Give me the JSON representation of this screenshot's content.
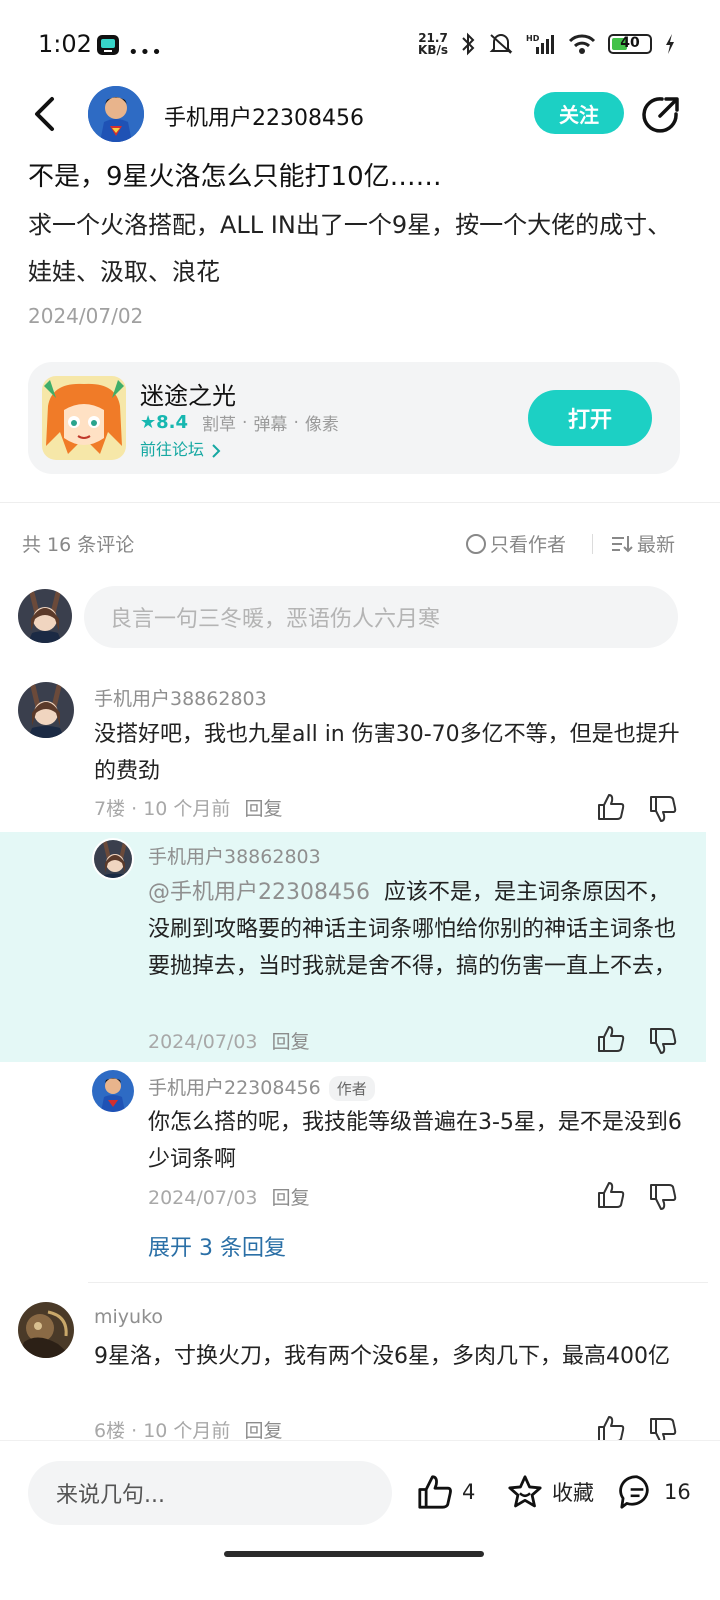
{
  "status_bar": {
    "time": "1:02",
    "net_speed_value": "21.7",
    "net_speed_unit": "KB/s",
    "battery": "40"
  },
  "post": {
    "author": "手机用户22308456",
    "follow_label": "关注",
    "title": "不是，9星火洛怎么只能打10亿……",
    "body": "求一个火洛搭配，ALL IN出了一个9星，按一个大佬的成寸、娃娃、汲取、浪花",
    "date": "2024/07/02"
  },
  "game_card": {
    "name": "迷途之光",
    "rating": "8.4",
    "tags": [
      "割草",
      "弹幕",
      "像素"
    ],
    "forum_link": "前往论坛",
    "open_label": "打开"
  },
  "comments_header": {
    "count_text": "共 16 条评论",
    "only_author": "只看作者",
    "sort": "最新"
  },
  "comment_input": {
    "placeholder": "良言一句三冬暖，恶语伤人六月寒"
  },
  "comments": [
    {
      "user": "手机用户38862803",
      "text": "没搭好吧，我也九星all in 伤害30-70多亿不等，但是也提升的费劲",
      "floor": "7楼",
      "time": "10 个月前",
      "reply_label": "回复"
    },
    {
      "user": "miyuko",
      "text": "9星洛，寸换火刀，我有两个没6星，多肉几下，最高400亿",
      "floor": "6楼",
      "time": "10 个月前",
      "reply_label": "回复"
    }
  ],
  "replies": [
    {
      "user": "手机用户38862803",
      "mention": "@手机用户22308456",
      "text": "应该不是，是主词条原因不，没刷到攻略要的神话主词条哪怕给你别的神话主词条也要抛掉去，当时我就是舍不得，搞的伤害一直上不去，",
      "date": "2024/07/03",
      "reply_label": "回复"
    },
    {
      "user": "手机用户22308456",
      "author_tag": "作者",
      "text": "你怎么搭的呢，我技能等级普遍在3-5星，是不是没到6少词条啊",
      "date": "2024/07/03",
      "reply_label": "回复"
    }
  ],
  "expand_replies": "展开 3 条回复",
  "bottom_bar": {
    "input_placeholder": "来说几句...",
    "like_count": "4",
    "collect_label": "收藏",
    "comment_count": "16"
  },
  "colors": {
    "accent": "#1cd0c4",
    "highlight_bg": "#e4f8f6",
    "link": "#2a6fa6"
  }
}
